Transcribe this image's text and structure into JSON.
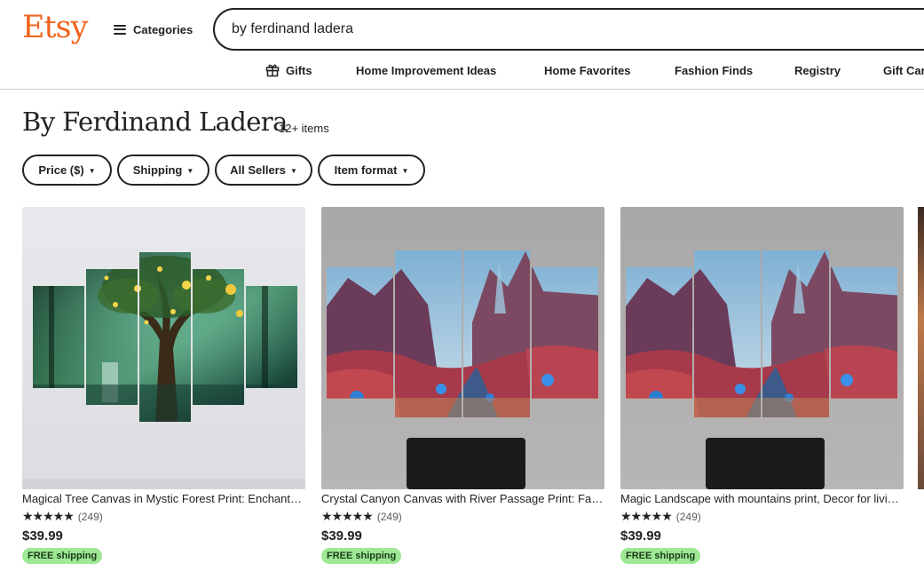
{
  "header": {
    "logo": "Etsy",
    "categories_label": "Categories",
    "search_value": "by ferdinand ladera"
  },
  "nav": {
    "items": [
      {
        "label": "Gifts",
        "icon": "gift-icon"
      },
      {
        "label": "Home Improvement Ideas"
      },
      {
        "label": "Home Favorites"
      },
      {
        "label": "Fashion Finds"
      },
      {
        "label": "Registry"
      },
      {
        "label": "Gift Cards"
      }
    ]
  },
  "page": {
    "title": "By Ferdinand Ladera",
    "item_count": "12+ items"
  },
  "filters": [
    {
      "label": "Price ($)"
    },
    {
      "label": "Shipping"
    },
    {
      "label": "All Sellers"
    },
    {
      "label": "Item format"
    }
  ],
  "products": [
    {
      "title": "Magical Tree Canvas in Mystic Forest Print: Enchanted Forest Wall Art",
      "stars": "★★★★★",
      "reviews": "(249)",
      "price": "$39.99",
      "badge": "FREE shipping"
    },
    {
      "title": "Crystal Canyon Canvas with River Passage Print: Fantasy Landscape",
      "stars": "★★★★★",
      "reviews": "(249)",
      "price": "$39.99",
      "badge": "FREE shipping"
    },
    {
      "title": "Magic Landscape with mountains print, Decor for living room",
      "stars": "★★★★★",
      "reviews": "(249)",
      "price": "$39.99",
      "badge": "FREE shipping"
    }
  ],
  "colors": {
    "brand": "#f1641e",
    "text": "#222222",
    "badge_bg": "#9ee896",
    "badge_text": "#1b3c17"
  }
}
